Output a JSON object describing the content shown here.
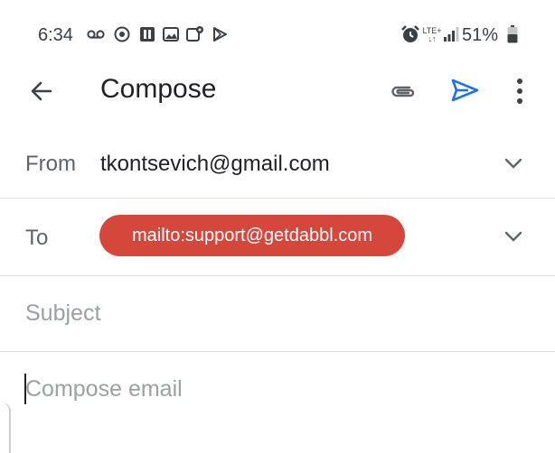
{
  "status_bar": {
    "time": "6:34",
    "network": "LTE+",
    "battery_percent": "51%",
    "icons": [
      "voicemail-icon",
      "whatsapp-icon",
      "bookmark-app-icon",
      "gallery-icon",
      "photo-location-icon",
      "play-store-icon",
      "alarm-icon",
      "lte-icon",
      "signal-icon",
      "battery-icon"
    ]
  },
  "app_bar": {
    "title": "Compose",
    "icons": [
      "back-arrow-icon",
      "attach-icon",
      "send-icon",
      "more-vert-icon"
    ],
    "accent_color": "#1a73e8"
  },
  "from": {
    "label": "From",
    "value": "tkontsevich@gmail.com"
  },
  "to": {
    "label": "To",
    "chip": "mailto:support@getdabbl.com",
    "chip_color": "#d5473b"
  },
  "subject": {
    "placeholder": "Subject"
  },
  "body": {
    "placeholder": "Compose email"
  }
}
